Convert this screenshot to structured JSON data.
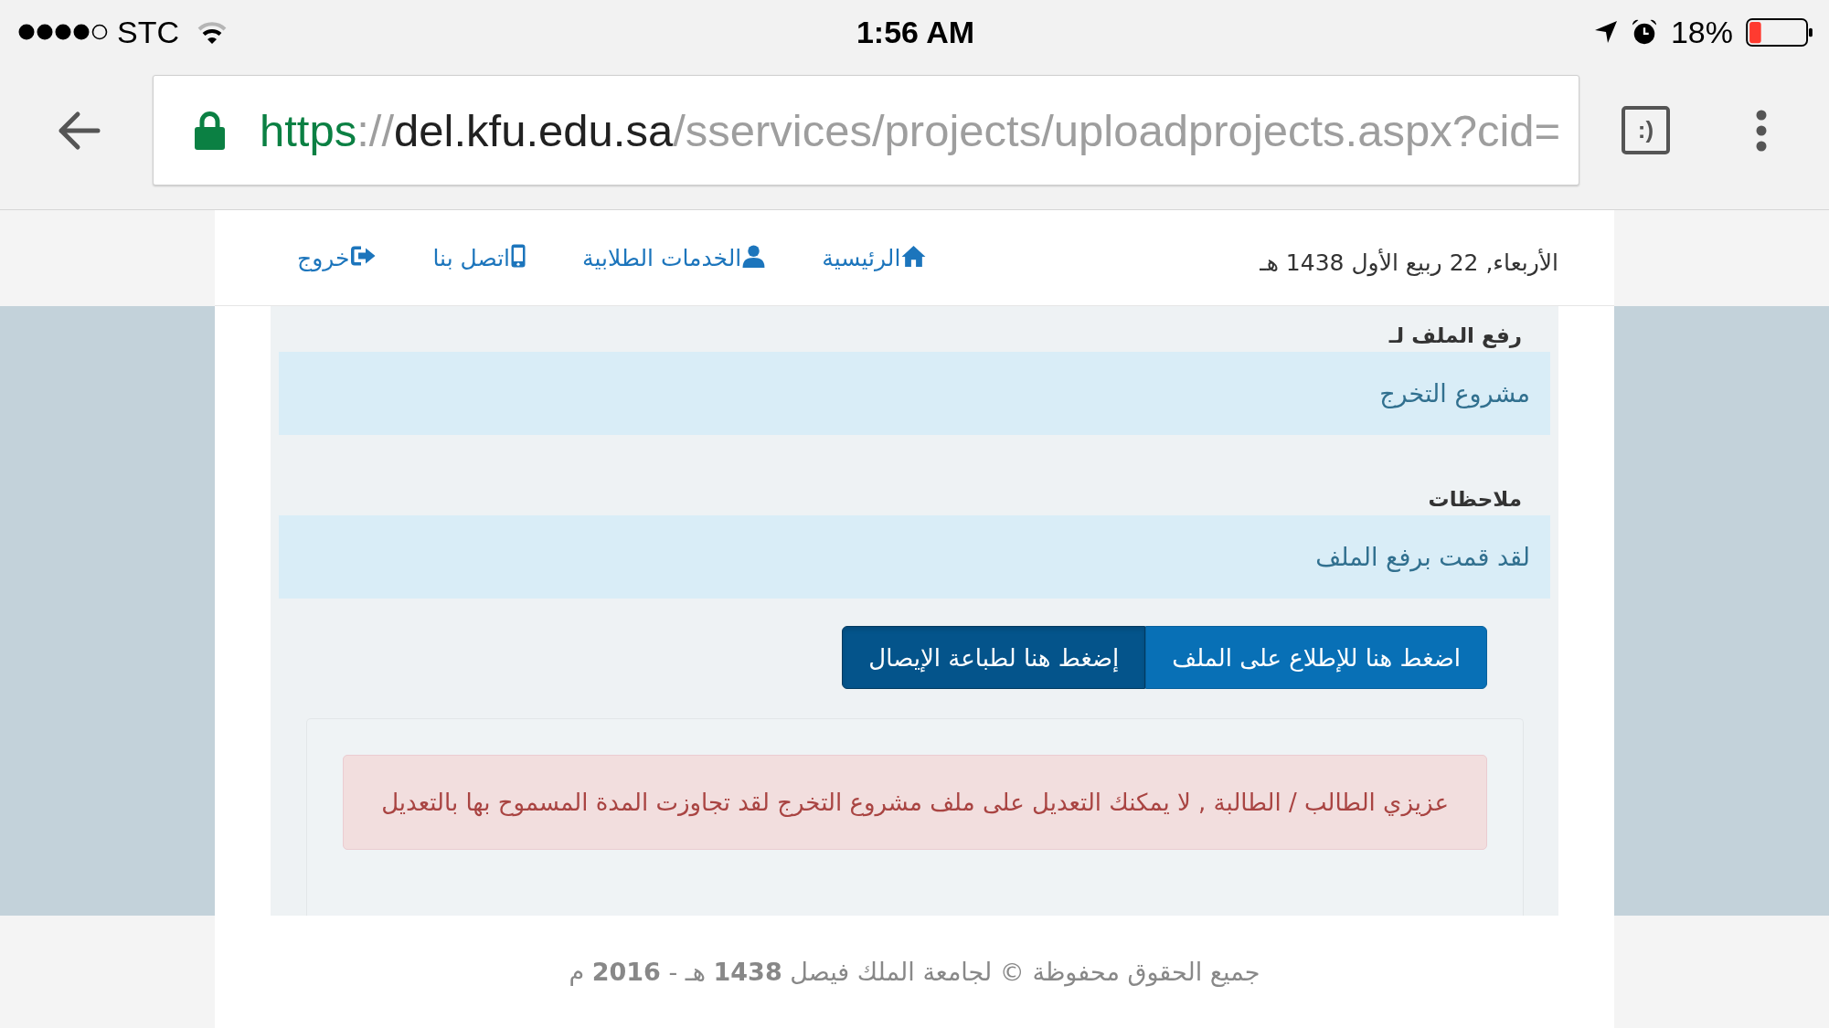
{
  "status_bar": {
    "carrier": "STC",
    "time": "1:56 AM",
    "battery": "18%"
  },
  "browser": {
    "url": {
      "scheme": "https",
      "separator": "://",
      "host": "del.kfu.edu.sa",
      "path": "/sservices/projects/uploadprojects.aspx?cid="
    },
    "tab_switcher": ":)"
  },
  "header": {
    "date": "الأربعاء, 22 ربيع الأول 1438 هـ",
    "nav": [
      {
        "kind": "home",
        "label": "الرئيسية"
      },
      {
        "kind": "user",
        "label": "الخدمات الطلابية"
      },
      {
        "kind": "mobile",
        "label": "اتصل بنا"
      },
      {
        "kind": "logout",
        "label": "خروج"
      }
    ]
  },
  "form": {
    "fields": [
      {
        "label": "رفع الملف لـ",
        "value": "مشروع التخرج"
      },
      {
        "label": "ملاحظات",
        "value": "لقد قمت برفع الملف"
      }
    ],
    "buttons": [
      {
        "label": "اضغط هنا للإطلاع على الملف",
        "pressed": false
      },
      {
        "label": "إضغط هنا لطباعة الإيصال",
        "pressed": true
      }
    ]
  },
  "alert": {
    "text": "عزيزي الطالب / الطالبة , لا يمكنك التعديل على ملف مشروع التخرج لقد تجاوزت المدة المسموح بها بالتعديل"
  },
  "footer": {
    "text": "جميع الحقوق محفوظة © لجامعة الملك فيصل **1438** هـ - **2016** م"
  }
}
